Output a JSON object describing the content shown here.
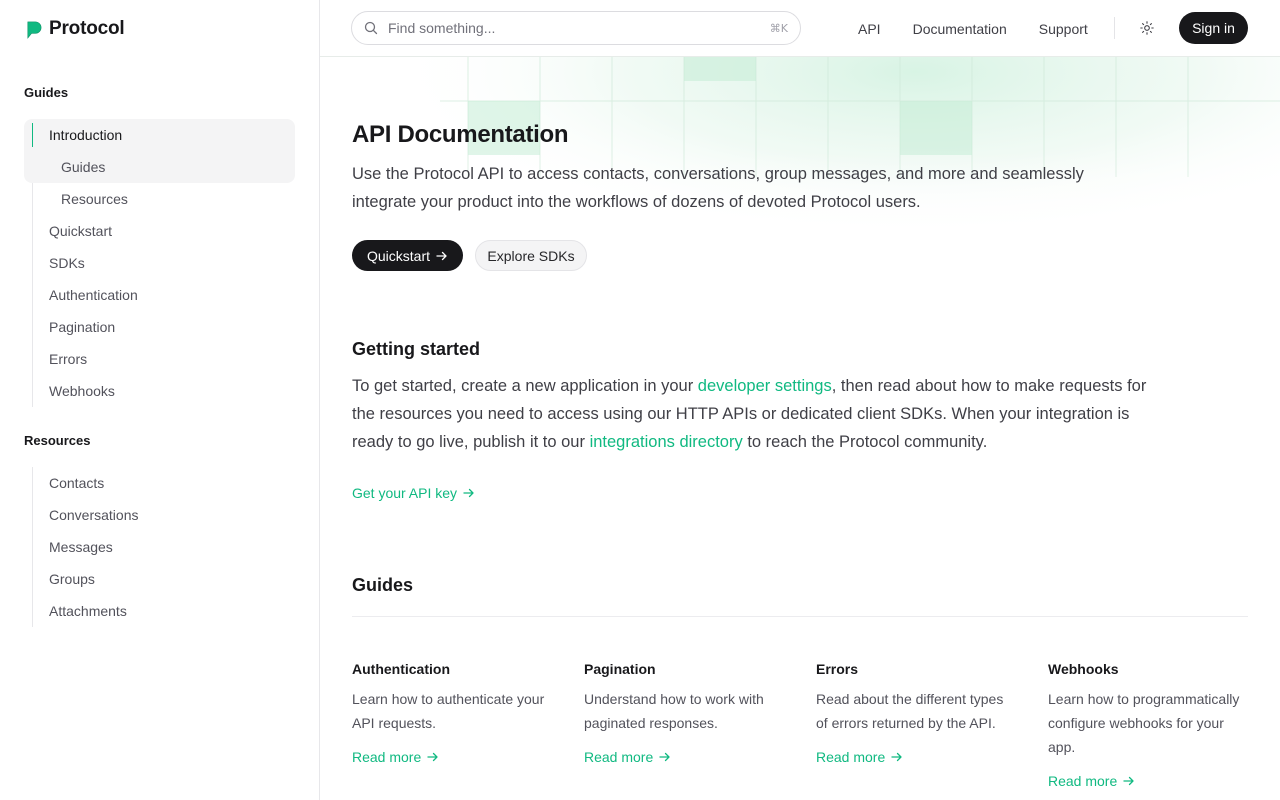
{
  "brand": {
    "name": "Protocol",
    "accent": "#10b981"
  },
  "sidebar": {
    "guides_heading": "Guides",
    "guides_items": [
      {
        "label": "Introduction",
        "active": true
      },
      {
        "label": "Guides",
        "sub": true
      },
      {
        "label": "Resources",
        "sub": true
      },
      {
        "label": "Quickstart"
      },
      {
        "label": "SDKs"
      },
      {
        "label": "Authentication"
      },
      {
        "label": "Pagination"
      },
      {
        "label": "Errors"
      },
      {
        "label": "Webhooks"
      }
    ],
    "resources_heading": "Resources",
    "resources_items": [
      {
        "label": "Contacts"
      },
      {
        "label": "Conversations"
      },
      {
        "label": "Messages"
      },
      {
        "label": "Groups"
      },
      {
        "label": "Attachments"
      }
    ]
  },
  "header": {
    "search_placeholder": "Find something...",
    "search_shortcut": "⌘K",
    "nav": [
      "API",
      "Documentation",
      "Support"
    ],
    "theme_icon": "sun-icon",
    "signin_label": "Sign in"
  },
  "main": {
    "title": "API Documentation",
    "lead": "Use the Protocol API to access contacts, conversations, group messages, and more and seamlessly integrate your product into the workflows of dozens of devoted Protocol users.",
    "primary_button": "Quickstart",
    "secondary_button": "Explore SDKs",
    "getting_started": {
      "title": "Getting started",
      "text_1": "To get started, create a new application in your ",
      "link_1": "developer settings",
      "text_2": ", then read about how to make requests for the resources you need to access using our HTTP APIs or dedicated client SDKs. When your integration is ready to go live, publish it to our ",
      "link_2": "integrations directory",
      "text_3": " to reach the Protocol community.",
      "api_key_link": "Get your API key"
    },
    "guides": {
      "title": "Guides",
      "cards": [
        {
          "title": "Authentication",
          "desc": "Learn how to authenticate your API requests.",
          "link": "Read more"
        },
        {
          "title": "Pagination",
          "desc": "Understand how to work with paginated responses.",
          "link": "Read more"
        },
        {
          "title": "Errors",
          "desc": "Read about the different types of errors returned by the API.",
          "link": "Read more"
        },
        {
          "title": "Webhooks",
          "desc": "Learn how to programmatically configure webhooks for your app.",
          "link": "Read more"
        }
      ]
    }
  }
}
